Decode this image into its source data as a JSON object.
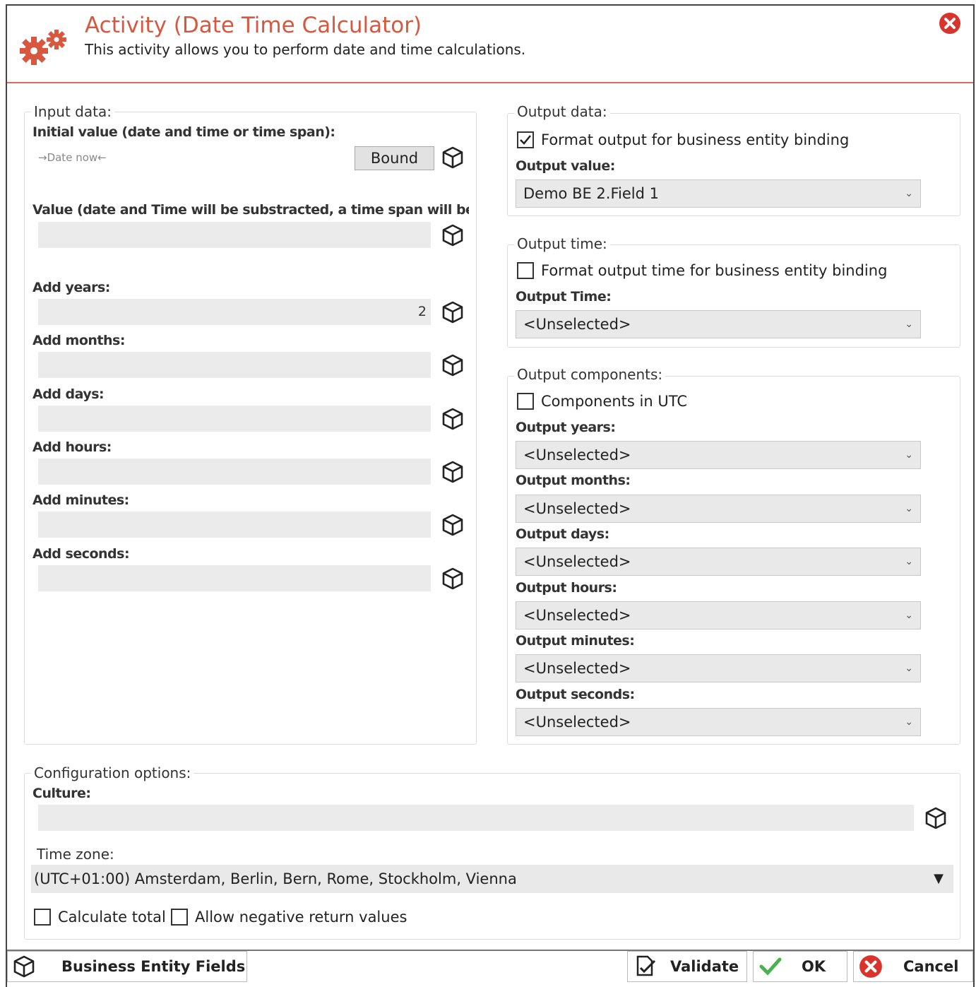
{
  "header": {
    "title": "Activity (Date Time Calculator)",
    "subtitle": "This activity allows you to perform date and time calculations."
  },
  "input_data": {
    "legend": "Input data:",
    "initial_label": "Initial value (date and time or time span):",
    "initial_hint": "→Date now←",
    "bound_label": "Bound",
    "value_label": "Value (date and Time will be substracted, a time span will be addec",
    "value": "",
    "years_label": "Add years:",
    "years_value": "2",
    "months_label": "Add months:",
    "months_value": "",
    "days_label": "Add days:",
    "days_value": "",
    "hours_label": "Add hours:",
    "hours_value": "",
    "minutes_label": "Add minutes:",
    "minutes_value": "",
    "seconds_label": "Add seconds:",
    "seconds_value": ""
  },
  "output_data": {
    "legend": "Output data:",
    "format_checkbox_label": "Format output for business entity binding",
    "format_checked": true,
    "value_label": "Output value:",
    "value_selected": "Demo BE 2.Field 1"
  },
  "output_time": {
    "legend": "Output time:",
    "format_checkbox_label": "Format output time for business entity binding",
    "format_checked": false,
    "time_label": "Output Time:",
    "time_selected": "<Unselected>"
  },
  "output_components": {
    "legend": "Output components:",
    "utc_label": "Components in UTC",
    "utc_checked": false,
    "years_label": "Output years:",
    "years_selected": "<Unselected>",
    "months_label": "Output months:",
    "months_selected": "<Unselected>",
    "days_label": "Output days:",
    "days_selected": "<Unselected>",
    "hours_label": "Output hours:",
    "hours_selected": "<Unselected>",
    "minutes_label": "Output minutes:",
    "minutes_selected": "<Unselected>",
    "seconds_label": "Output seconds:",
    "seconds_selected": "<Unselected>"
  },
  "configuration": {
    "legend": "Configuration options:",
    "culture_label": "Culture:",
    "culture_value": "",
    "timezone_label": "Time zone:",
    "timezone_selected": "(UTC+01:00) Amsterdam, Berlin, Bern, Rome, Stockholm, Vienna",
    "calculate_total_label": "Calculate total",
    "calculate_total_checked": false,
    "allow_negative_label": "Allow negative return values",
    "allow_negative_checked": false
  },
  "footer": {
    "business_entity_label": "Business Entity Fields",
    "validate_label": "Validate",
    "ok_label": "OK",
    "cancel_label": "Cancel"
  },
  "colors": {
    "accent": "#d8583f",
    "close_red": "#d9342b",
    "ok_green": "#4caf50",
    "field_bg": "#ebebeb"
  },
  "icons": {
    "app": "gears-icon",
    "close": "close-icon",
    "bind": "cube-icon",
    "validate": "validate-icon",
    "ok": "check-icon",
    "cancel": "cancel-icon"
  }
}
